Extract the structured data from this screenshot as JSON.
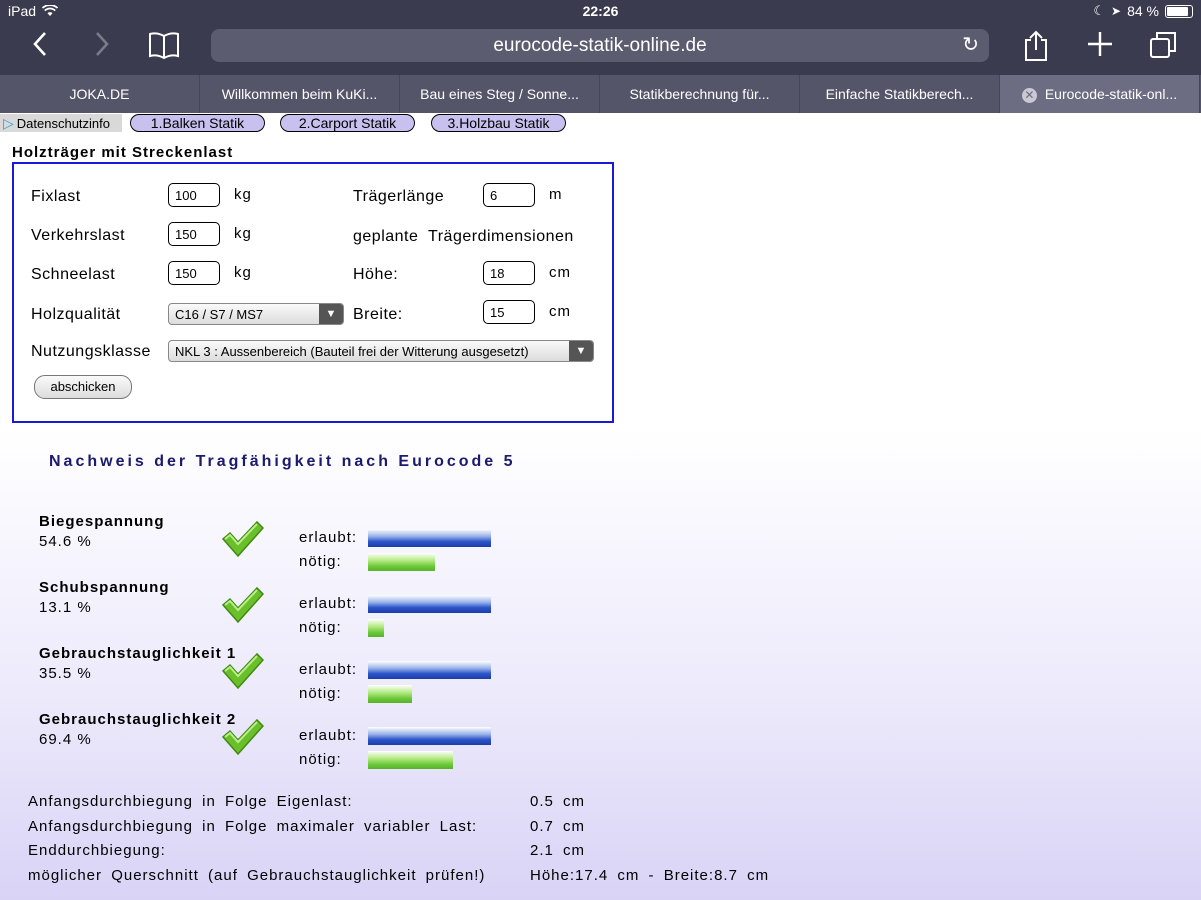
{
  "status": {
    "device": "iPad",
    "time": "22:26",
    "battery": "84 %"
  },
  "browser": {
    "url": "eurocode-statik-online.de",
    "tabs": [
      {
        "label": "JOKA.DE"
      },
      {
        "label": "Willkommen beim KuKi..."
      },
      {
        "label": "Bau eines Steg / Sonne..."
      },
      {
        "label": "Statikberechnung für..."
      },
      {
        "label": "Einfache Statikberech..."
      },
      {
        "label": "Eurocode-statik-onl...",
        "active": true
      }
    ]
  },
  "nav": {
    "datenschutz": "Datenschutzinfo",
    "links": [
      "1.Balken Statik",
      "2.Carport Statik",
      "3.Holzbau Statik"
    ]
  },
  "form": {
    "title": "Holzträger mit Streckenlast",
    "fixlast": {
      "label": "Fixlast",
      "value": "100",
      "unit": "kg"
    },
    "verkehrslast": {
      "label": "Verkehrslast",
      "value": "150",
      "unit": "kg"
    },
    "schneelast": {
      "label": "Schneelast",
      "value": "150",
      "unit": "kg"
    },
    "holzqualitaet": {
      "label": "Holzqualität",
      "value": "C16 / S7 / MS7"
    },
    "nutzungsklasse": {
      "label": "Nutzungsklasse",
      "value": "NKL 3 : Aussenbereich (Bauteil frei der Witterung ausgesetzt)"
    },
    "traegerlaenge": {
      "label": "Trägerlänge",
      "value": "6",
      "unit": "m"
    },
    "dimensionen_label": "geplante Trägerdimensionen",
    "hoehe": {
      "label": "Höhe:",
      "value": "18",
      "unit": "cm"
    },
    "breite": {
      "label": "Breite:",
      "value": "15",
      "unit": "cm"
    },
    "submit": "abschicken"
  },
  "results": {
    "title": "Nachweis der Tragfähigkeit nach Eurocode 5",
    "allowed_label": "erlaubt:",
    "needed_label": "nötig:",
    "checks": [
      {
        "name": "Biegespannung",
        "percent": "54.6  %",
        "ratio": 0.546
      },
      {
        "name": "Schubspannung",
        "percent": "13.1  %",
        "ratio": 0.131
      },
      {
        "name": "Gebrauchstauglichkeit 1",
        "percent": "35.5  %",
        "ratio": 0.355
      },
      {
        "name": "Gebrauchstauglichkeit 2",
        "percent": "69.4  %",
        "ratio": 0.694
      }
    ],
    "summary": [
      {
        "label": "Anfangsdurchbiegung in Folge Eigenlast:",
        "value": "0.5 cm"
      },
      {
        "label": "Anfangsdurchbiegung in Folge maximaler variabler Last:",
        "value": "0.7 cm"
      },
      {
        "label": "Enddurchbiegung:",
        "value": "2.1 cm"
      },
      {
        "label": "möglicher Querschnitt (auf Gebrauchstauglichkeit prüfen!)",
        "value": "Höhe:17.4 cm - Breite:8.7 cm"
      }
    ]
  },
  "colors": {
    "chrome": "#3b3b4f",
    "form_border": "#1a1ad6",
    "heading": "#1a1a6e"
  }
}
